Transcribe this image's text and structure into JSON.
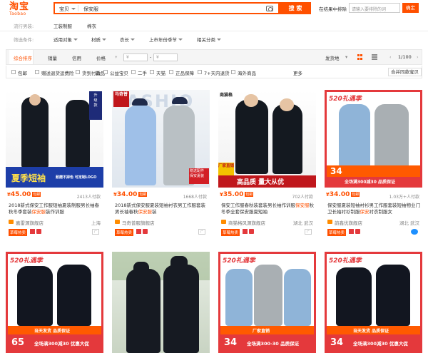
{
  "header": {
    "logo_cn": "淘宝",
    "logo_en": "Taobao",
    "search_cat": "宝贝",
    "search_value": "保安服",
    "search_button": "搜 索",
    "in_result_label": "在结果中排除",
    "in_result_placeholder": "请输入要排除的词",
    "ok_button": "确定"
  },
  "filters": {
    "row1_label": "流行男装:",
    "row1_items": [
      "工装制服",
      "棉衣"
    ],
    "row2_label": "筛选条件:",
    "row2_items": [
      "适用对象",
      "材质",
      "衣长",
      "上市年份季节",
      "相关分类"
    ]
  },
  "sortbar": {
    "items": [
      "综合排序",
      "销量",
      "信用",
      "价格"
    ],
    "price_min": "¥",
    "price_max": "¥",
    "ship_from": "发货地",
    "page": "1/100"
  },
  "checks": [
    "包邮",
    "赠送退货运费险",
    "货到付款",
    "新品",
    "公益宝贝",
    "二手",
    "天猫",
    "正品保障",
    "7+天内退货",
    "海外商品"
  ],
  "more": "更多",
  "merge": "合并同款宝贝",
  "products": [
    {
      "price": "45.00",
      "tag": "包邮",
      "sold": "2413人付款",
      "title_pre": "2018新式保安工作服短袖夏装制服男长袖春秋冬季套装",
      "title_hl": "保安服",
      "title_post": "装作训服",
      "shop": "嘉雷源旗舰店",
      "loc": "上海",
      "badge": "草莓热卖",
      "banner": "夏季短袖",
      "banner_sub": "耐磨不掉色 可定制LOGO"
    },
    {
      "price": "34.00",
      "tag": "包邮",
      "sold": "1668人付款",
      "title_pre": "2018新式保安服夏装短袖衬衣男工作服套装男长袖春秋",
      "title_hl": "保安服",
      "title_post": "装",
      "shop": "马奇普服旗舰店",
      "loc": "",
      "badge": "草莓热卖",
      "banner": "马奇普",
      "banner_sub": "赠送配件 保安夏装"
    },
    {
      "price": "35.00",
      "tag": "包邮",
      "sold": "702人付款",
      "title_pre": "保安工作服春秋装套装男长袖作训服",
      "title_hl": "保安服",
      "title_post": "秋冬季全套保安服夏短袖",
      "shop": "商猫格风源旗舰店",
      "loc": "湖北 武汉",
      "badge": "草莓热卖",
      "banner": "高品质 量大从优",
      "banner_sub": "厂家直销"
    },
    {
      "price": "34.00",
      "tag": "包邮",
      "sold": "1.03万+人付款",
      "title_pre": "保安服夏装短袖衬衫男工作服套装短袖物业门卫长袖衬衫制服",
      "title_hl": "保安",
      "title_post": "衬衣制服女",
      "shop": "韵鑫优旗舰店",
      "loc": "湖北 武汉",
      "badge": "草莓热卖",
      "banner": "520礼遇季",
      "banner_sub": "全场满300减30 品质保证"
    }
  ],
  "row2": [
    {
      "banner": "520礼遇季",
      "price": "65",
      "foot": "全场满300减30 优惠大促",
      "foot2": "当天发货 品质保证"
    },
    {
      "banner": "",
      "price": "",
      "foot": "",
      "foot2": ""
    },
    {
      "banner": "520礼遇季",
      "price": "34",
      "foot": "全场满300-30 品质保证",
      "foot2": "厂家直销"
    },
    {
      "banner": "520礼遇季",
      "price": "34",
      "foot": "全场满300减30 优惠大促",
      "foot2": "当天发货 品质保证"
    }
  ]
}
